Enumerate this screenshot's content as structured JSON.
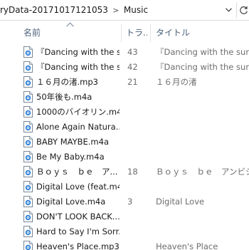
{
  "address": {
    "path": [
      "ryData-20171017121053",
      "Music"
    ]
  },
  "columns": {
    "name": "名前",
    "track": "トラ...",
    "title": "タイトル"
  },
  "files": [
    {
      "name": "『Dancing with the s...",
      "track": "43",
      "title": "『Dancing with the sunsh"
    },
    {
      "name": "『Dancing with the s...",
      "track": "42",
      "title": "『Dancing with the sunsh"
    },
    {
      "name": "１６月の渚.mp3",
      "track": "21",
      "title": "１６月の渚"
    },
    {
      "name": "50年後も.m4a",
      "track": "",
      "title": ""
    },
    {
      "name": "1000のバイオリン.m4a",
      "track": "",
      "title": ""
    },
    {
      "name": "Alone Again Natura...",
      "track": "",
      "title": ""
    },
    {
      "name": "BABY MAYBE.m4a",
      "track": "",
      "title": ""
    },
    {
      "name": "Be My Baby.m4a",
      "track": "",
      "title": ""
    },
    {
      "name": "Ｂｏｙｓ　ｂｅ　ア...",
      "track": "18",
      "title": "Ｂｏｙｓ　ｂｅ　アンビシ"
    },
    {
      "name": "Digital Love (feat.m4a",
      "track": "",
      "title": ""
    },
    {
      "name": "Digital Love.m4a",
      "track": "3",
      "title": "Digital Love"
    },
    {
      "name": "DON'T LOOK BACK....",
      "track": "",
      "title": ""
    },
    {
      "name": "Hard to Say I'm Sorr...",
      "track": "",
      "title": ""
    },
    {
      "name": "Heaven's Place.mp3",
      "track": "",
      "title": "Heaven's Place"
    }
  ],
  "icons": {
    "file": "audio-file-icon",
    "dropdown": "chevron-down-icon",
    "refresh": "refresh-icon",
    "sort": "sort-ascending-icon",
    "separator": "chevron-right-icon"
  },
  "colors": {
    "header_text": "#4c607a",
    "secondary_text": "#6d6d6d",
    "icon_blue": "#2a7dd6"
  }
}
